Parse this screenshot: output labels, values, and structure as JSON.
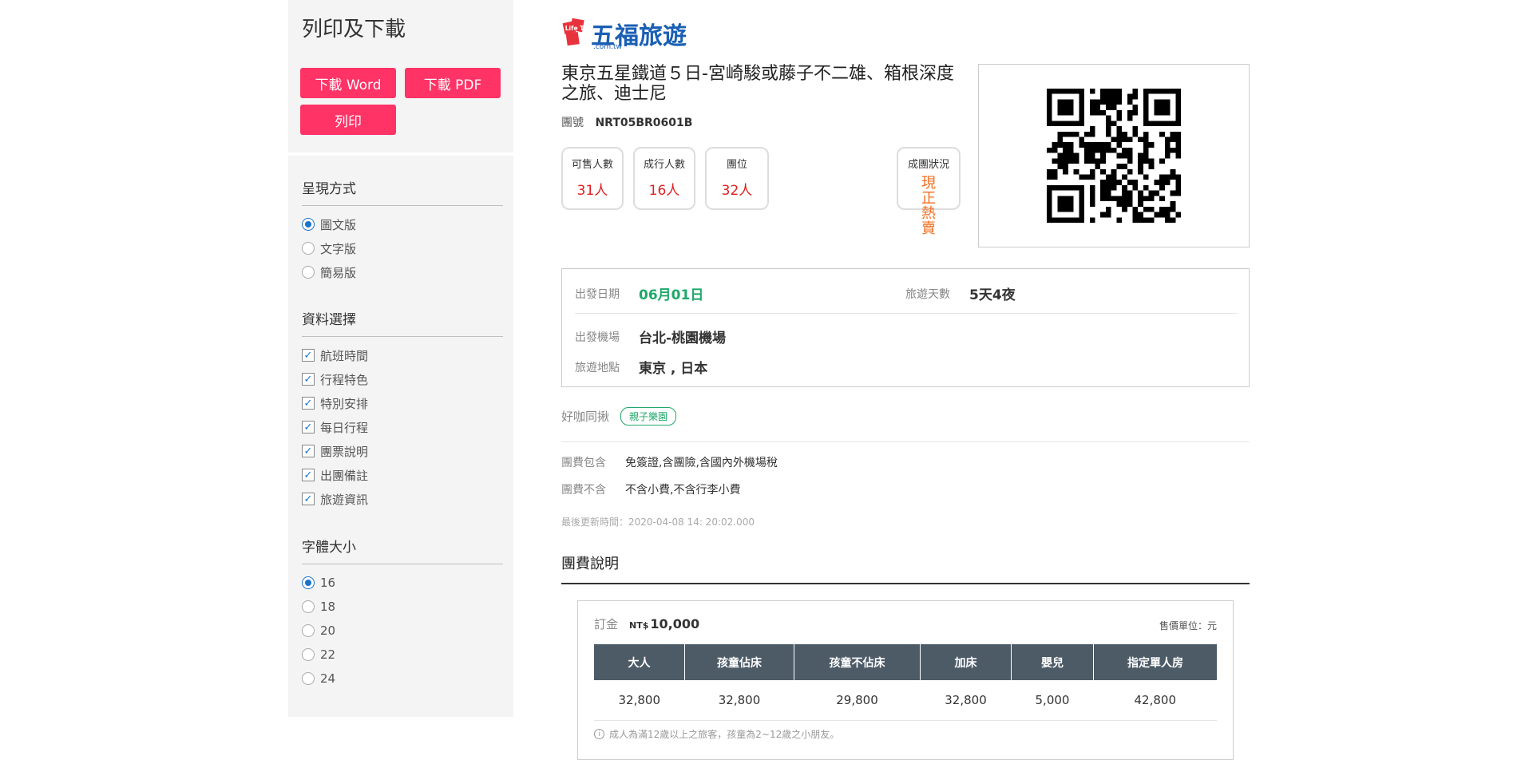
{
  "sidebar": {
    "title": "列印及下載",
    "buttons": {
      "word": "下載 Word",
      "pdf": "下載 PDF",
      "print": "列印"
    },
    "display_mode": {
      "heading": "呈現方式",
      "options": [
        "圖文版",
        "文字版",
        "簡易版"
      ],
      "selected": "圖文版"
    },
    "data_select": {
      "heading": "資料選擇",
      "options": [
        "航班時間",
        "行程特色",
        "特別安排",
        "每日行程",
        "團票說明",
        "出團備註",
        "旅遊資訊"
      ]
    },
    "font_size": {
      "heading": "字體大小",
      "options": [
        "16",
        "18",
        "20",
        "22",
        "24"
      ],
      "selected": "16"
    }
  },
  "brand": {
    "name": "五福旅遊",
    "badge": "Life Tour",
    "domain": ".com.tw"
  },
  "tour": {
    "title": "東京五星鐵道５日-宮崎駿或藤子不二雄、箱根深度之旅、迪士尼",
    "code_label": "團號",
    "code": "NRT05BR0601B"
  },
  "stats": {
    "available_label": "可售人數",
    "available": "31人",
    "confirmed_label": "成行人數",
    "confirmed": "16人",
    "seats_label": "團位",
    "seats": "32人",
    "status_label": "成團狀況",
    "status": "現正熱賣"
  },
  "info": {
    "depart_date_label": "出發日期",
    "depart_date": "06月01日",
    "duration_label": "旅遊天數",
    "duration": "5天4夜",
    "airport_label": "出發機場",
    "airport": "台北-桃園機場",
    "destination_label": "旅遊地點",
    "destination": "東京 , 日本"
  },
  "theme": {
    "label": "好咖同揪",
    "tag": "親子樂園"
  },
  "fees": {
    "include_label": "團費包含",
    "include": "免簽證,含團險,含國內外機場稅",
    "exclude_label": "團費不含",
    "exclude": "不含小費,不含行李小費"
  },
  "updated": "最後更新時間：2020-04-08 14: 20:02.000",
  "price_section": {
    "title": "團費說明",
    "deposit_label": "訂金",
    "deposit_currency": "NT$",
    "deposit": "10,000",
    "unit": "售價單位：元",
    "headers": [
      "大人",
      "孩童佔床",
      "孩童不佔床",
      "加床",
      "嬰兒",
      "指定單人房"
    ],
    "values": [
      "32,800",
      "32,800",
      "29,800",
      "32,800",
      "5,000",
      "42,800"
    ],
    "note": "成人為滿12歲以上之旅客，孩童為2~12歲之小朋友。"
  },
  "colors": {
    "accent": "#ff3366",
    "brand": "#1a5fb4",
    "green": "#1fa86a",
    "red": "#e02020",
    "orange": "#f06f20",
    "table_header": "#4d5b67"
  }
}
